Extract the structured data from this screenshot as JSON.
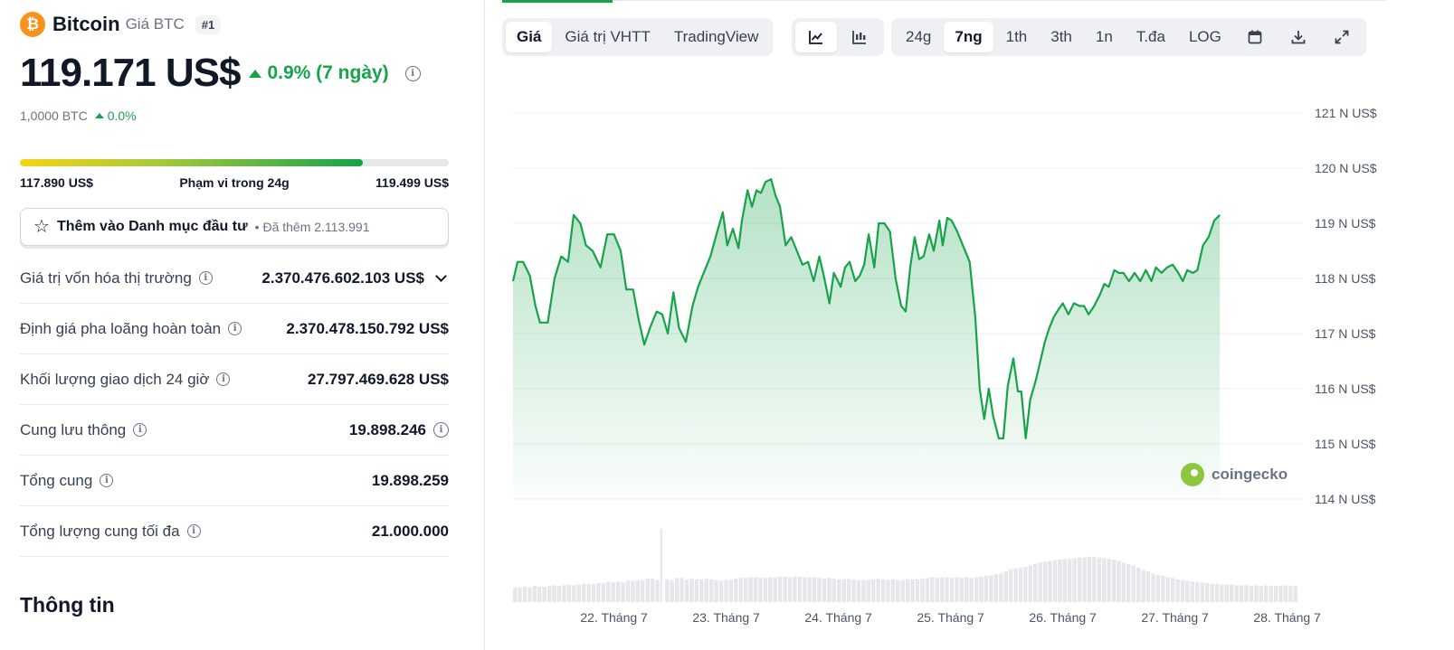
{
  "coin": {
    "logo_glyph": "₿",
    "name": "Bitcoin",
    "symbol_label": "Giá BTC",
    "rank": "#1",
    "price": "119.171 US$",
    "change": "0.9% (7 ngày)",
    "btc_amount": "1,0000 BTC",
    "btc_change": "0.0%"
  },
  "range": {
    "low": "117.890 US$",
    "label": "Phạm vi trong 24g",
    "high": "119.499 US$",
    "fill_percent": 80
  },
  "watchlist": {
    "label": "Thêm vào Danh mục đầu tư",
    "added": "• Đã thêm 2.113.991"
  },
  "stats": [
    {
      "label": "Giá trị vốn hóa thị trường",
      "value": "2.370.476.602.103 US$"
    },
    {
      "label": "Định giá pha loãng hoàn toàn",
      "value": "2.370.478.150.792 US$"
    },
    {
      "label": "Khối lượng giao dịch 24 giờ",
      "value": "27.797.469.628 US$"
    },
    {
      "label": "Cung lưu thông",
      "value": "19.898.246"
    },
    {
      "label": "Tổng cung",
      "value": "19.898.259"
    },
    {
      "label": "Tổng lượng cung tối đa",
      "value": "21.000.000"
    }
  ],
  "section_title": "Thông tin",
  "chart_tabs": {
    "type": [
      "Giá",
      "Giá trị VHTT",
      "TradingView"
    ],
    "ranges": [
      "24g",
      "7ng",
      "1th",
      "3th",
      "1n",
      "T.đa",
      "LOG"
    ],
    "active_type": "Giá",
    "active_range": "7ng"
  },
  "icons": {
    "line_chart": "line-chart-icon",
    "candlestick": "candlestick-icon",
    "calendar": "calendar-icon",
    "download": "download-icon",
    "fullscreen": "fullscreen-icon"
  },
  "watermark": "coingecko",
  "colors": {
    "up": "#16a34a",
    "line": "#16a34a",
    "area": "#16a34a",
    "btc": "#f7931a"
  },
  "chart_data": {
    "type": "area",
    "y_ticks": [
      "121 N US$",
      "120 N US$",
      "119 N US$",
      "118 N US$",
      "117 N US$",
      "116 N US$",
      "115 N US$",
      "114 N US$"
    ],
    "y_tick_values": [
      121,
      120,
      119,
      118,
      117,
      116,
      115,
      114
    ],
    "ylim": [
      114,
      121
    ],
    "x_ticks": [
      "22. Tháng 7",
      "23. Tháng 7",
      "24. Tháng 7",
      "25. Tháng 7",
      "26. Tháng 7",
      "27. Tháng 7",
      "28. Tháng 7"
    ],
    "x_tick_days": [
      1,
      2,
      3,
      4,
      5,
      6,
      7
    ],
    "xlim": [
      0.1,
      7.1
    ],
    "grid": true,
    "series": [
      {
        "values": [
          [
            0.1,
            117.95
          ],
          [
            0.14,
            118.3
          ],
          [
            0.19,
            118.3
          ],
          [
            0.25,
            118.05
          ],
          [
            0.3,
            117.5
          ],
          [
            0.34,
            117.2
          ],
          [
            0.41,
            117.2
          ],
          [
            0.47,
            118.0
          ],
          [
            0.53,
            118.4
          ],
          [
            0.59,
            118.3
          ],
          [
            0.64,
            119.15
          ],
          [
            0.7,
            119.0
          ],
          [
            0.75,
            118.6
          ],
          [
            0.81,
            118.5
          ],
          [
            0.88,
            118.2
          ],
          [
            0.94,
            118.8
          ],
          [
            1.0,
            118.8
          ],
          [
            1.06,
            118.5
          ],
          [
            1.11,
            117.8
          ],
          [
            1.17,
            117.8
          ],
          [
            1.22,
            117.25
          ],
          [
            1.27,
            116.8
          ],
          [
            1.32,
            117.1
          ],
          [
            1.38,
            117.4
          ],
          [
            1.43,
            117.35
          ],
          [
            1.48,
            117.0
          ],
          [
            1.53,
            117.75
          ],
          [
            1.58,
            117.1
          ],
          [
            1.64,
            116.85
          ],
          [
            1.7,
            117.5
          ],
          [
            1.75,
            117.85
          ],
          [
            1.81,
            118.15
          ],
          [
            1.86,
            118.4
          ],
          [
            1.92,
            118.85
          ],
          [
            1.97,
            119.2
          ],
          [
            2.01,
            118.6
          ],
          [
            2.06,
            118.9
          ],
          [
            2.11,
            118.55
          ],
          [
            2.14,
            119.05
          ],
          [
            2.19,
            119.6
          ],
          [
            2.23,
            119.3
          ],
          [
            2.27,
            119.6
          ],
          [
            2.31,
            119.55
          ],
          [
            2.35,
            119.75
          ],
          [
            2.4,
            119.8
          ],
          [
            2.44,
            119.5
          ],
          [
            2.48,
            119.3
          ],
          [
            2.53,
            118.6
          ],
          [
            2.58,
            118.75
          ],
          [
            2.63,
            118.5
          ],
          [
            2.68,
            118.25
          ],
          [
            2.73,
            118.3
          ],
          [
            2.78,
            117.95
          ],
          [
            2.83,
            118.4
          ],
          [
            2.87,
            118.05
          ],
          [
            2.92,
            117.55
          ],
          [
            2.96,
            118.1
          ],
          [
            3.02,
            117.85
          ],
          [
            3.06,
            118.2
          ],
          [
            3.1,
            118.3
          ],
          [
            3.15,
            117.95
          ],
          [
            3.19,
            118.05
          ],
          [
            3.23,
            118.25
          ],
          [
            3.27,
            118.8
          ],
          [
            3.32,
            118.2
          ],
          [
            3.36,
            119.0
          ],
          [
            3.41,
            119.0
          ],
          [
            3.46,
            118.85
          ],
          [
            3.51,
            118.0
          ],
          [
            3.56,
            117.5
          ],
          [
            3.6,
            117.4
          ],
          [
            3.64,
            118.2
          ],
          [
            3.68,
            118.75
          ],
          [
            3.72,
            118.35
          ],
          [
            3.76,
            118.4
          ],
          [
            3.81,
            118.8
          ],
          [
            3.85,
            118.5
          ],
          [
            3.9,
            119.05
          ],
          [
            3.93,
            118.6
          ],
          [
            3.97,
            119.1
          ],
          [
            4.01,
            119.05
          ],
          [
            4.06,
            118.85
          ],
          [
            4.11,
            118.6
          ],
          [
            4.17,
            118.3
          ],
          [
            4.22,
            117.3
          ],
          [
            4.26,
            116.0
          ],
          [
            4.3,
            115.45
          ],
          [
            4.34,
            116.0
          ],
          [
            4.38,
            115.5
          ],
          [
            4.43,
            115.1
          ],
          [
            4.47,
            115.1
          ],
          [
            4.51,
            116.05
          ],
          [
            4.56,
            116.55
          ],
          [
            4.6,
            115.95
          ],
          [
            4.63,
            115.95
          ],
          [
            4.67,
            115.1
          ],
          [
            4.71,
            115.8
          ],
          [
            4.76,
            116.15
          ],
          [
            4.8,
            116.5
          ],
          [
            4.84,
            116.85
          ],
          [
            4.88,
            117.1
          ],
          [
            4.92,
            117.3
          ],
          [
            4.95,
            117.4
          ],
          [
            5.0,
            117.55
          ],
          [
            5.05,
            117.35
          ],
          [
            5.1,
            117.55
          ],
          [
            5.15,
            117.5
          ],
          [
            5.19,
            117.5
          ],
          [
            5.23,
            117.35
          ],
          [
            5.28,
            117.5
          ],
          [
            5.33,
            117.7
          ],
          [
            5.37,
            117.9
          ],
          [
            5.41,
            117.85
          ],
          [
            5.46,
            118.15
          ],
          [
            5.5,
            118.1
          ],
          [
            5.54,
            118.1
          ],
          [
            5.59,
            117.95
          ],
          [
            5.64,
            118.1
          ],
          [
            5.69,
            117.95
          ],
          [
            5.74,
            118.15
          ],
          [
            5.79,
            117.95
          ],
          [
            5.83,
            118.2
          ],
          [
            5.88,
            118.1
          ],
          [
            5.93,
            118.2
          ],
          [
            5.98,
            118.25
          ],
          [
            6.03,
            118.1
          ],
          [
            6.07,
            117.95
          ],
          [
            6.11,
            118.15
          ],
          [
            6.16,
            118.1
          ],
          [
            6.2,
            118.15
          ],
          [
            6.25,
            118.6
          ],
          [
            6.3,
            118.75
          ],
          [
            6.35,
            119.05
          ],
          [
            6.4,
            119.15
          ]
        ]
      }
    ],
    "volume": [
      0.2,
      0.2,
      0.21,
      0.2,
      0.22,
      0.21,
      0.21,
      0.22,
      0.23,
      0.22,
      0.23,
      0.24,
      0.23,
      0.24,
      0.25,
      0.25,
      0.25,
      0.26,
      0.26,
      0.28,
      0.27,
      0.28,
      0.27,
      0.29,
      0.29,
      0.3,
      0.3,
      0.32,
      0.32,
      0.3,
      0.4,
      0.31,
      0.3,
      0.33,
      0.33,
      0.31,
      0.32,
      0.31,
      0.31,
      0.32,
      0.31,
      0.3,
      0.29,
      0.3,
      0.3,
      0.32,
      0.33,
      0.33,
      0.34,
      0.34,
      0.33,
      0.33,
      0.34,
      0.34,
      0.35,
      0.35,
      0.34,
      0.35,
      0.35,
      0.34,
      0.34,
      0.34,
      0.33,
      0.32,
      0.33,
      0.32,
      0.31,
      0.31,
      0.32,
      0.31,
      0.3,
      0.3,
      0.3,
      0.31,
      0.32,
      0.31,
      0.3,
      0.31,
      0.3,
      0.3,
      0.31,
      0.31,
      0.31,
      0.32,
      0.33,
      0.34,
      0.33,
      0.34,
      0.34,
      0.33,
      0.34,
      0.33,
      0.34,
      0.33,
      0.34,
      0.35,
      0.36,
      0.36,
      0.38,
      0.39,
      0.42,
      0.45,
      0.46,
      0.47,
      0.48,
      0.5,
      0.52,
      0.54,
      0.55,
      0.56,
      0.57,
      0.58,
      0.59,
      0.59,
      0.6,
      0.61,
      0.61,
      0.62,
      0.62,
      0.61,
      0.6,
      0.59,
      0.58,
      0.56,
      0.54,
      0.52,
      0.5,
      0.47,
      0.44,
      0.42,
      0.39,
      0.37,
      0.36,
      0.34,
      0.33,
      0.31,
      0.3,
      0.29,
      0.28,
      0.27,
      0.27,
      0.26,
      0.25,
      0.25,
      0.24,
      0.24,
      0.24,
      0.23,
      0.23,
      0.23,
      0.22,
      0.23,
      0.22,
      0.23,
      0.22,
      0.22,
      0.22,
      0.23,
      0.22,
      0.22
    ],
    "volume_spike_index": 30,
    "volume_spike_value": 1.0
  }
}
